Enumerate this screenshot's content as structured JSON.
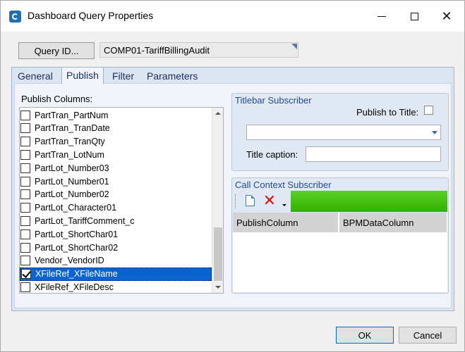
{
  "window": {
    "title": "Dashboard Query Properties"
  },
  "query": {
    "button_label": "Query ID...",
    "value": "COMP01-TariffBillingAudit"
  },
  "tabs": [
    {
      "label": "General"
    },
    {
      "label": "Publish"
    },
    {
      "label": "Filter"
    },
    {
      "label": "Parameters"
    }
  ],
  "active_tab": "Publish",
  "publish_columns": {
    "label": "Publish Columns:",
    "items": [
      {
        "label": "PartTran_PartNum",
        "checked": false
      },
      {
        "label": "PartTran_TranDate",
        "checked": false
      },
      {
        "label": "PartTran_TranQty",
        "checked": false
      },
      {
        "label": "PartTran_LotNum",
        "checked": false
      },
      {
        "label": "PartLot_Number03",
        "checked": false
      },
      {
        "label": "PartLot_Number01",
        "checked": false
      },
      {
        "label": "PartLot_Number02",
        "checked": false
      },
      {
        "label": "PartLot_Character01",
        "checked": false
      },
      {
        "label": "PartLot_TariffComment_c",
        "checked": false
      },
      {
        "label": "PartLot_ShortChar01",
        "checked": false
      },
      {
        "label": "PartLot_ShortChar02",
        "checked": false
      },
      {
        "label": "Vendor_VendorID",
        "checked": false
      },
      {
        "label": "XFileRef_XFileName",
        "checked": true,
        "selected": true
      },
      {
        "label": "XFileRef_XFileDesc",
        "checked": false
      }
    ]
  },
  "titlebar_subscriber": {
    "title": "Titlebar Subscriber",
    "publish_to_title_label": "Publish to Title:",
    "publish_to_title_checked": false,
    "combo_value": "",
    "caption_label": "Title caption:",
    "caption_value": ""
  },
  "call_context_subscriber": {
    "title": "Call Context Subscriber",
    "columns": [
      "PublishColumn",
      "BPMDataColumn"
    ],
    "toolbar_accent": "#3ab800"
  },
  "buttons": {
    "ok": "OK",
    "cancel": "Cancel"
  },
  "colors": {
    "selection": "#0a64d0",
    "group_title": "#244b8a",
    "delete": "#d8140a"
  }
}
